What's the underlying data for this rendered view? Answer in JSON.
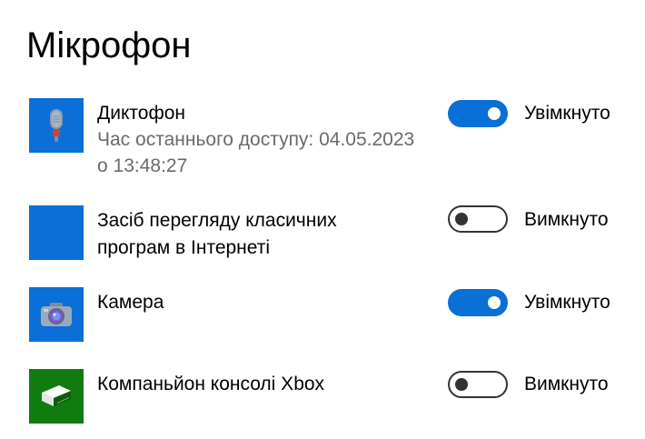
{
  "page": {
    "title": "Мікрофон"
  },
  "colors": {
    "accent": "#0a6fd6",
    "xbox_green": "#107c10",
    "secondary_text": "#6b6b6b"
  },
  "apps": [
    {
      "name": "Диктофон",
      "sub_line1": "Час останнього доступу: 04.05.2023",
      "sub_line2": "о 13:48:27",
      "icon": "microphone-icon",
      "enabled": true,
      "status": "Увімкнуто"
    },
    {
      "name_line1": "Засіб перегляду класичних",
      "name_line2": "програм в Інтернеті",
      "icon": "blank-app-icon",
      "enabled": false,
      "status": "Вимкнуто"
    },
    {
      "name": "Камера",
      "icon": "camera-icon",
      "enabled": true,
      "status": "Увімкнуто"
    },
    {
      "name": "Компаньйон консолі Xbox",
      "icon": "xbox-console-icon",
      "enabled": false,
      "status": "Вимкнуто"
    }
  ]
}
